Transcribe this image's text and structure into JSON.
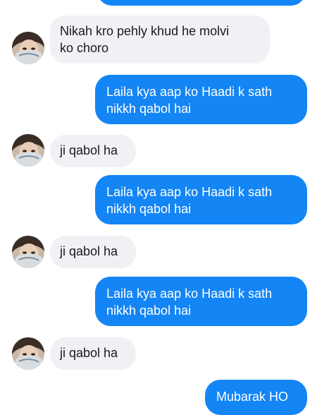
{
  "colors": {
    "sent_bubble": "#1485f5",
    "received_bubble": "#f2f0f5",
    "background": "#ffffff"
  },
  "messages": [
    {
      "side": "sent",
      "text": ""
    },
    {
      "side": "received",
      "text": "Nikah kro pehly khud he molvi\nko choro",
      "avatar": "contact-avatar"
    },
    {
      "side": "sent",
      "text": "Laila kya aap ko Haadi k sath\nnikkh qabol hai"
    },
    {
      "side": "received",
      "text": "ji qabol ha",
      "avatar": "contact-avatar"
    },
    {
      "side": "sent",
      "text": "Laila kya aap ko Haadi k sath\nnikkh qabol hai"
    },
    {
      "side": "received",
      "text": "ji qabol ha",
      "avatar": "contact-avatar"
    },
    {
      "side": "sent",
      "text": "Laila kya aap ko Haadi k sath\nnikkh qabol hai"
    },
    {
      "side": "received",
      "text": "ji qabol ha",
      "avatar": "contact-avatar"
    },
    {
      "side": "sent",
      "text": "Mubarak HO"
    }
  ]
}
